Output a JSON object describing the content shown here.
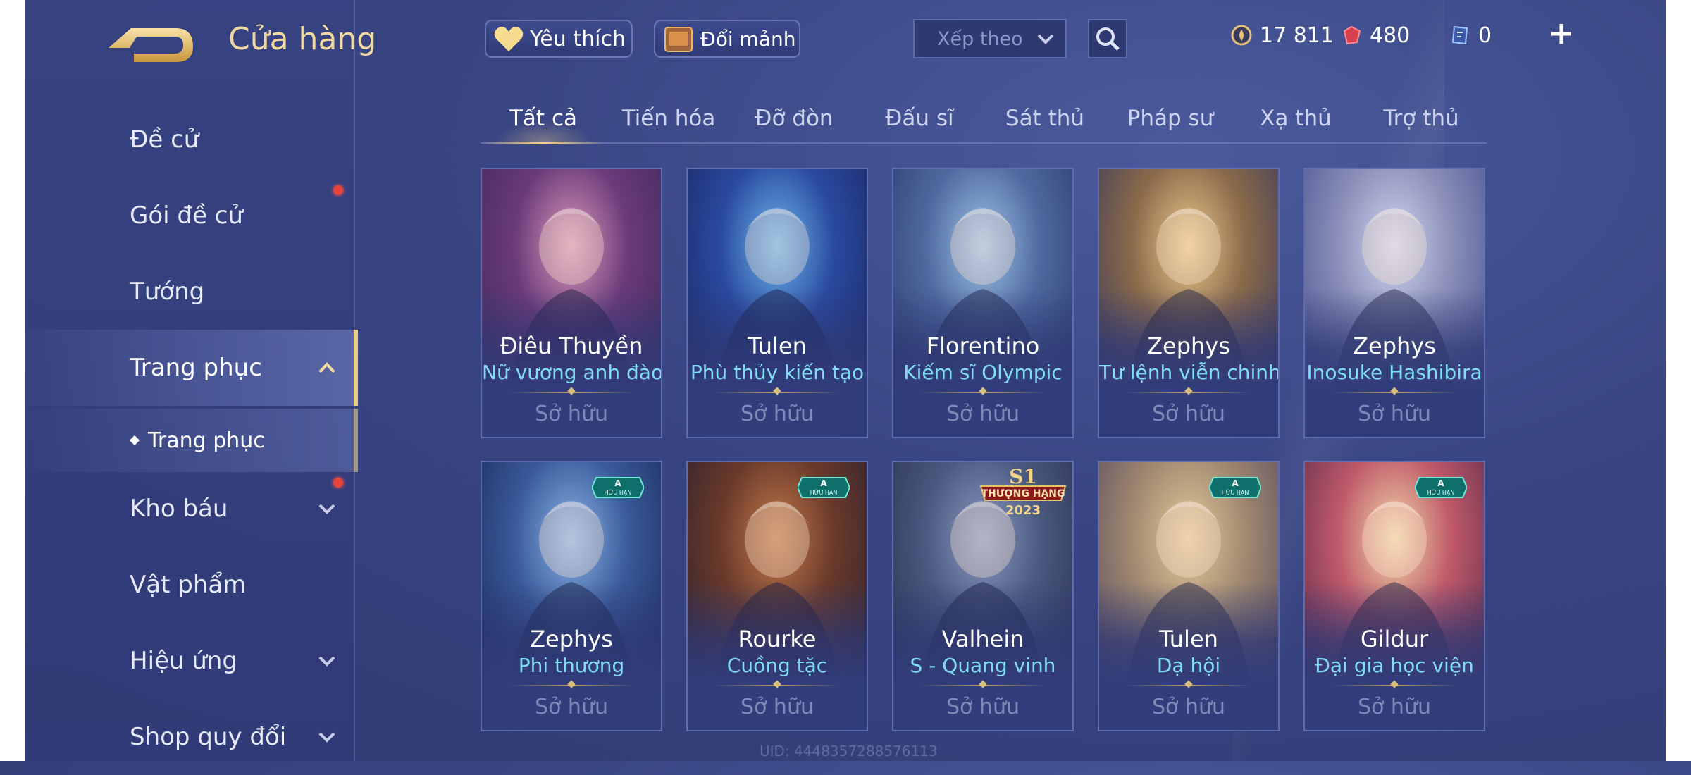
{
  "header": {
    "title": "Cửa hàng",
    "favorites_label": "Yêu thích",
    "exchange_label": "Đổi mảnh",
    "sort_label": "Xếp theo",
    "currencies": [
      {
        "name": "vang",
        "value": "17 811",
        "color": "#e6c07a"
      },
      {
        "name": "quan-huy",
        "value": "480",
        "color": "#e0475a"
      },
      {
        "name": "ve",
        "value": "0",
        "color": "#8ab8ff"
      }
    ]
  },
  "sidebar": {
    "items": [
      {
        "label": "Đề cử",
        "dot": false
      },
      {
        "label": "Gói đề cử",
        "dot": true
      },
      {
        "label": "Tướng",
        "dot": false
      },
      {
        "label": "Trang phục",
        "active": true,
        "expanded": true
      },
      {
        "label": "Kho báu",
        "dot": true,
        "chevron": "down"
      },
      {
        "label": "Vật phẩm"
      },
      {
        "label": "Hiệu ứng",
        "chevron": "down"
      },
      {
        "label": "Shop quy đổi",
        "chevron": "down"
      }
    ],
    "sub_item": "Trang phục"
  },
  "tabs": [
    "Tất cả",
    "Tiến hóa",
    "Đỡ đòn",
    "Đấu sĩ",
    "Sát thủ",
    "Pháp sư",
    "Xạ thủ",
    "Trợ thủ"
  ],
  "active_tab": "Tất cả",
  "cards": [
    {
      "hero": "Điêu Thuyền",
      "skin": "Nữ vương anh đào",
      "status": "Sở hữu",
      "palette": [
        "#d99ab8",
        "#6b3a7a",
        "#3a2a5a"
      ]
    },
    {
      "hero": "Tulen",
      "skin": "Phù thủy kiến tạo",
      "status": "Sở hữu",
      "palette": [
        "#6bb6ea",
        "#2a4aa0",
        "#1a2660"
      ]
    },
    {
      "hero": "Florentino",
      "skin": "Kiếm sĩ Olympic",
      "status": "Sở hữu",
      "palette": [
        "#9fc3e6",
        "#4f6aa0",
        "#2a3a70"
      ]
    },
    {
      "hero": "Zephys",
      "skin": "Tư lệnh viễn chinh",
      "status": "Sở hữu",
      "palette": [
        "#e9c98a",
        "#8a6a4a",
        "#3a3a5a"
      ]
    },
    {
      "hero": "Zephys",
      "skin": "Inosuke Hashibira",
      "status": "Sở hữu",
      "palette": [
        "#cfd6ee",
        "#8a90b8",
        "#4a5090"
      ]
    },
    {
      "hero": "Zephys",
      "skin": "Phi thương",
      "status": "Sở hữu",
      "palette": [
        "#8ab4e6",
        "#3a5a9a",
        "#1a2a5a"
      ],
      "badge": "A · HỮU HẠN"
    },
    {
      "hero": "Rourke",
      "skin": "Cuồng tặc",
      "status": "Sở hữu",
      "palette": [
        "#c47a4a",
        "#6a3a2a",
        "#2a2030"
      ],
      "badge": "A · HỮU HẠN"
    },
    {
      "hero": "Valhein",
      "skin": "S - Quang vinh",
      "status": "Sở hữu",
      "palette": [
        "#8a9ac0",
        "#4a5a80",
        "#2a3050"
      ],
      "badge": "S1 THƯỢNG HẠNG 2023"
    },
    {
      "hero": "Tulen",
      "skin": "Dạ hội",
      "status": "Sở hữu",
      "palette": [
        "#e6c89a",
        "#a08a70",
        "#5a4a60"
      ],
      "badge": "A · HỮU HẠN"
    },
    {
      "hero": "Gildur",
      "skin": "Đại gia học viện",
      "status": "Sở hữu",
      "palette": [
        "#f0d8a8",
        "#c05a6a",
        "#5a2a4a"
      ],
      "badge": "A · HỮU HẠN"
    }
  ],
  "uid_text": "UID: 4448357288576113"
}
